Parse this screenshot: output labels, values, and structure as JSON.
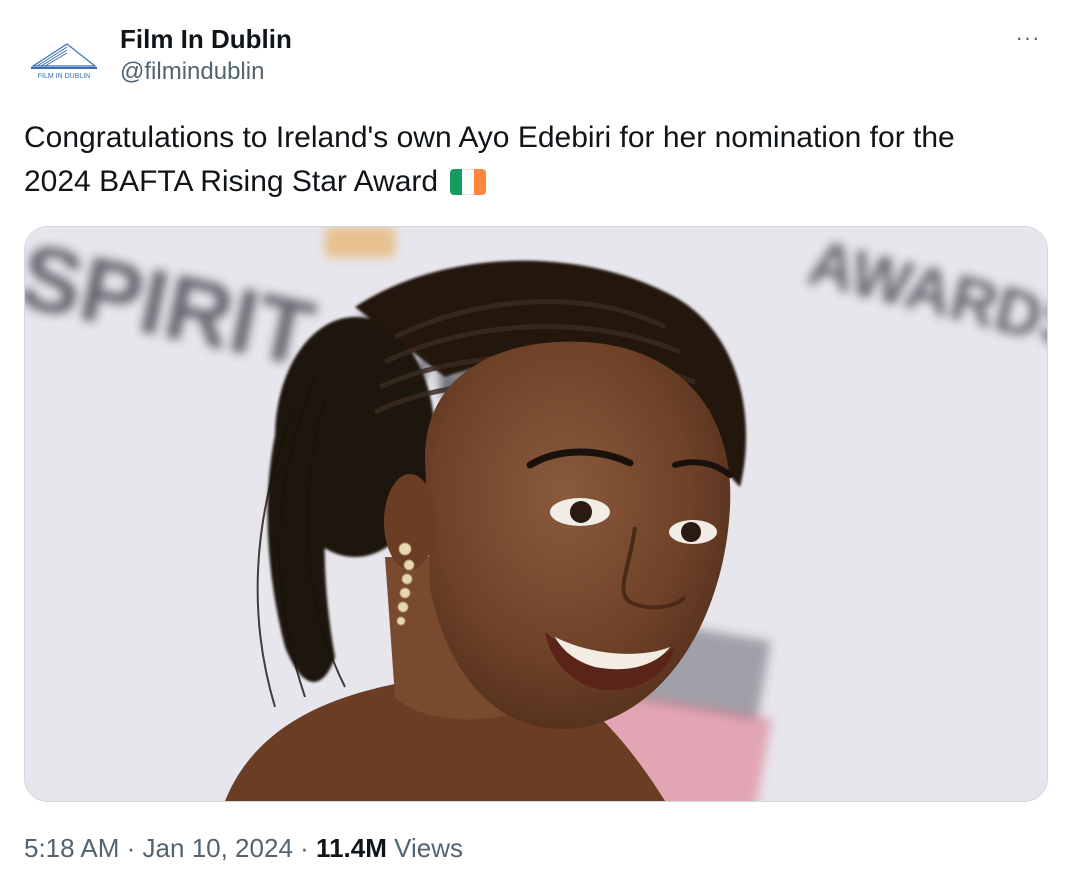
{
  "account": {
    "display_name": "Film In Dublin",
    "handle": "@filmindublin",
    "avatar_logo_text": "FILM IN DUBLIN"
  },
  "menu": {
    "more_label": "···"
  },
  "tweet": {
    "text": "Congratulations to Ireland's own Ayo Edebiri for her nomination for the 2024 BAFTA Rising Star Award",
    "flag_emoji": "ireland-flag"
  },
  "media": {
    "background_text_left": "SPIRIT AWARDS",
    "background_text_right": "AWARDS"
  },
  "meta": {
    "time": "5:18 AM",
    "date": "Jan 10, 2024",
    "separator": "·",
    "views_count": "11.4M",
    "views_label": "Views"
  },
  "colors": {
    "text": "#0f1419",
    "secondary": "#536471",
    "border": "#cfd9de",
    "flag_green": "#169b62",
    "flag_white": "#ffffff",
    "flag_orange": "#ff883e"
  }
}
